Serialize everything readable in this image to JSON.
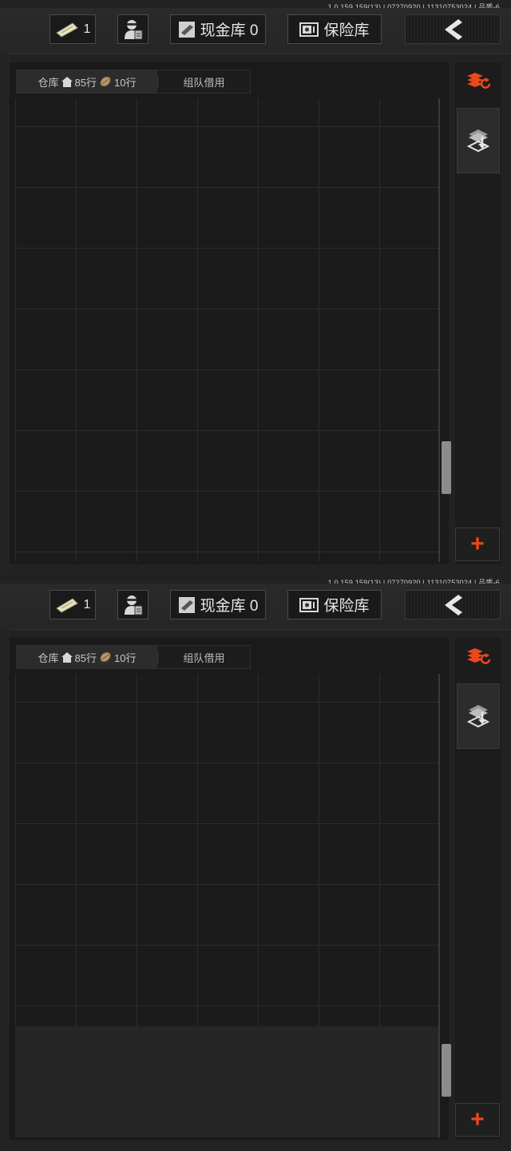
{
  "version": "1.0.159.159(13) | 07270920 | 11310753024 | 品质-6",
  "topbar": {
    "ticket_count": "1",
    "cash_label": "现金库 0",
    "safe_label": "保险库"
  },
  "tabs": {
    "warehouse_label": "仓库",
    "rows_total": "85行",
    "rows_extra": "10行",
    "team_label": "组队借用"
  },
  "sidebar": {
    "add_label": "+"
  },
  "colors": {
    "accent": "#e8491d",
    "background": "#1e1e1e"
  },
  "icons": [
    "ticket-icon",
    "agent-icon",
    "cash-icon",
    "safe-icon",
    "back-chevron-icon",
    "home-icon",
    "coin-bag-icon",
    "sort-icon",
    "stash-transfer-icon"
  ]
}
